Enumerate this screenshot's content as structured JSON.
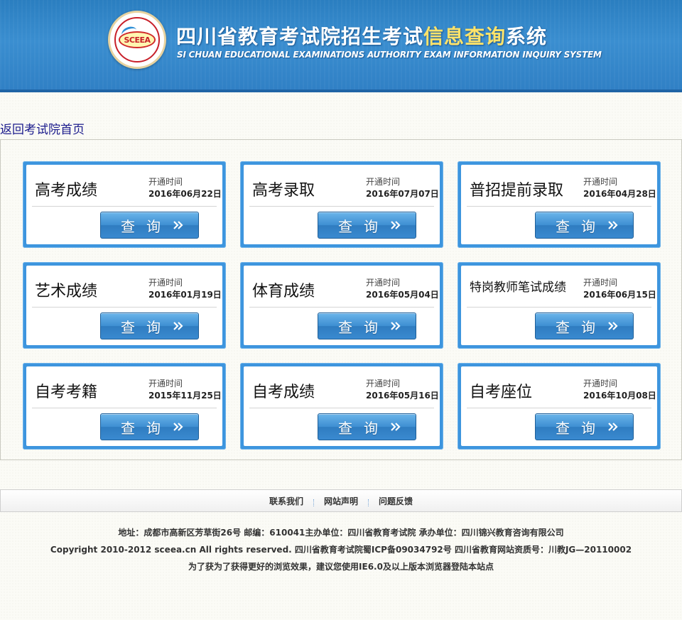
{
  "header": {
    "logo_text": "SCEEA",
    "title_main": "四川省教育考试院招生考试",
    "title_highlight": "信息查询",
    "title_tail": "系统",
    "title_en": "SI CHUAN EDUCATIONAL EXAMINATIONS AUTHORITY EXAM INFORMATION INQUIRY SYSTEM"
  },
  "nav": {
    "back_label": "返回考试院首页"
  },
  "cards": [
    {
      "title": "高考成绩",
      "open_label": "开通时间",
      "date": "2016年06月22日",
      "button": "查询"
    },
    {
      "title": "高考录取",
      "open_label": "开通时间",
      "date": "2016年07月07日",
      "button": "查询"
    },
    {
      "title": "普招提前录取",
      "open_label": "开通时间",
      "date": "2016年04月28日",
      "button": "查询"
    },
    {
      "title": "艺术成绩",
      "open_label": "开通时间",
      "date": "2016年01月19日",
      "button": "查询"
    },
    {
      "title": "体育成绩",
      "open_label": "开通时间",
      "date": "2016年05月04日",
      "button": "查询"
    },
    {
      "title": "特岗教师笔试成绩",
      "open_label": "开通时间",
      "date": "2016年06月15日",
      "button": "查询"
    },
    {
      "title": "自考考籍",
      "open_label": "开通时间",
      "date": "2015年11月25日",
      "button": "查询"
    },
    {
      "title": "自考成绩",
      "open_label": "开通时间",
      "date": "2016年05月16日",
      "button": "查询"
    },
    {
      "title": "自考座位",
      "open_label": "开通时间",
      "date": "2016年10月08日",
      "button": "查询"
    }
  ],
  "footer": {
    "links": [
      "联系我们",
      "网站声明",
      "问题反馈"
    ],
    "address": "地址：成都市高新区芳草街26号 邮编：610041",
    "organizer": "主办单位：四川省教育考试院 承办单位：四川锦兴教育咨询有限公司",
    "copyright": "Copyright 2010-2012 sceea.cn All rights reserved. 四川省教育考试院",
    "icp": "蜀ICP备09034792号 四川省教育网站资质号：川教JG—20110002",
    "browser_note": "为了获为了获得更好的浏览效果，建议您使用IE6.0及以上版本浏览器登陆本站点"
  },
  "colors": {
    "header_blue": "#2f7fc4",
    "card_border": "#3d95de",
    "title_highlight": "#ffe36a",
    "link": "#1a1a8c"
  }
}
